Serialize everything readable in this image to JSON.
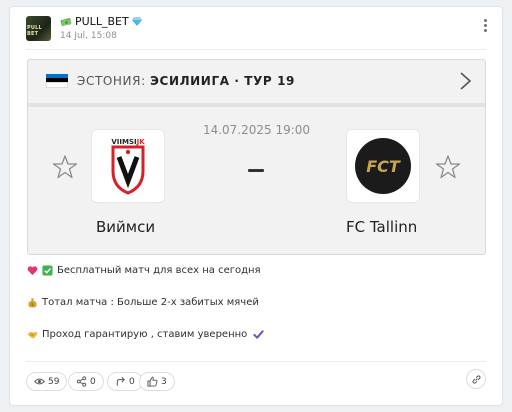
{
  "post": {
    "channel_name": "PULL_BET",
    "timestamp": "14 Jul, 15:08",
    "avatar_text": "PULL BET"
  },
  "match": {
    "country_prefix": "ЭСТОНИЯ:",
    "league": "ЭСИЛИИГА · ТУР 19",
    "datetime": "14.07.2025 19:00",
    "home_team": "Виймси",
    "away_team": "FC Tallinn",
    "home_logo_text": "VIIMSI",
    "home_logo_suffix": "JK",
    "away_logo_text": "FCT"
  },
  "text_lines": [
    "Бесплатный матч для всех на сегодня",
    "Тотал матча : Больше 2-х забитых мячей",
    "Проход гарантирую , ставим уверенно"
  ],
  "reactions": {
    "views": "59",
    "shares": "0",
    "forwards": "0",
    "likes": "3"
  },
  "colors": {
    "flag_blue": "#0072ce",
    "flag_black": "#000000",
    "flag_white": "#ffffff",
    "viimsi_red": "#d6202a"
  }
}
